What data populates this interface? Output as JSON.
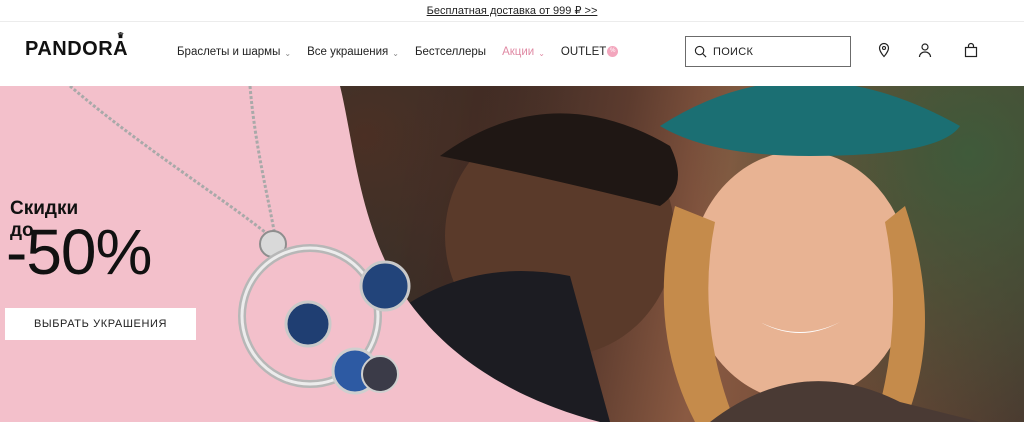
{
  "topbar": {
    "promo_text": "Бесплатная доставка от 999 ₽ >>"
  },
  "header": {
    "logo": "PANDORA",
    "nav": [
      {
        "label": "Браслеты и шармы",
        "has_dropdown": true
      },
      {
        "label": "Все украшения",
        "has_dropdown": true
      },
      {
        "label": "Бестселлеры",
        "has_dropdown": false
      },
      {
        "label": "Акции",
        "has_dropdown": true
      },
      {
        "label": "OUTLET",
        "has_dropdown": false,
        "badge": "%"
      }
    ],
    "search": {
      "placeholder": "ПОИСК"
    },
    "icons": [
      "location-pin-icon",
      "user-icon",
      "shopping-bag-icon"
    ]
  },
  "hero": {
    "title": "Скидки\nдо",
    "big": "-50%",
    "cta_label": "ВЫБРАТЬ УКРАШЕНИЯ"
  },
  "colors": {
    "sale_pink": "#e08aa4",
    "hero_pink": "#f3c0cb"
  }
}
